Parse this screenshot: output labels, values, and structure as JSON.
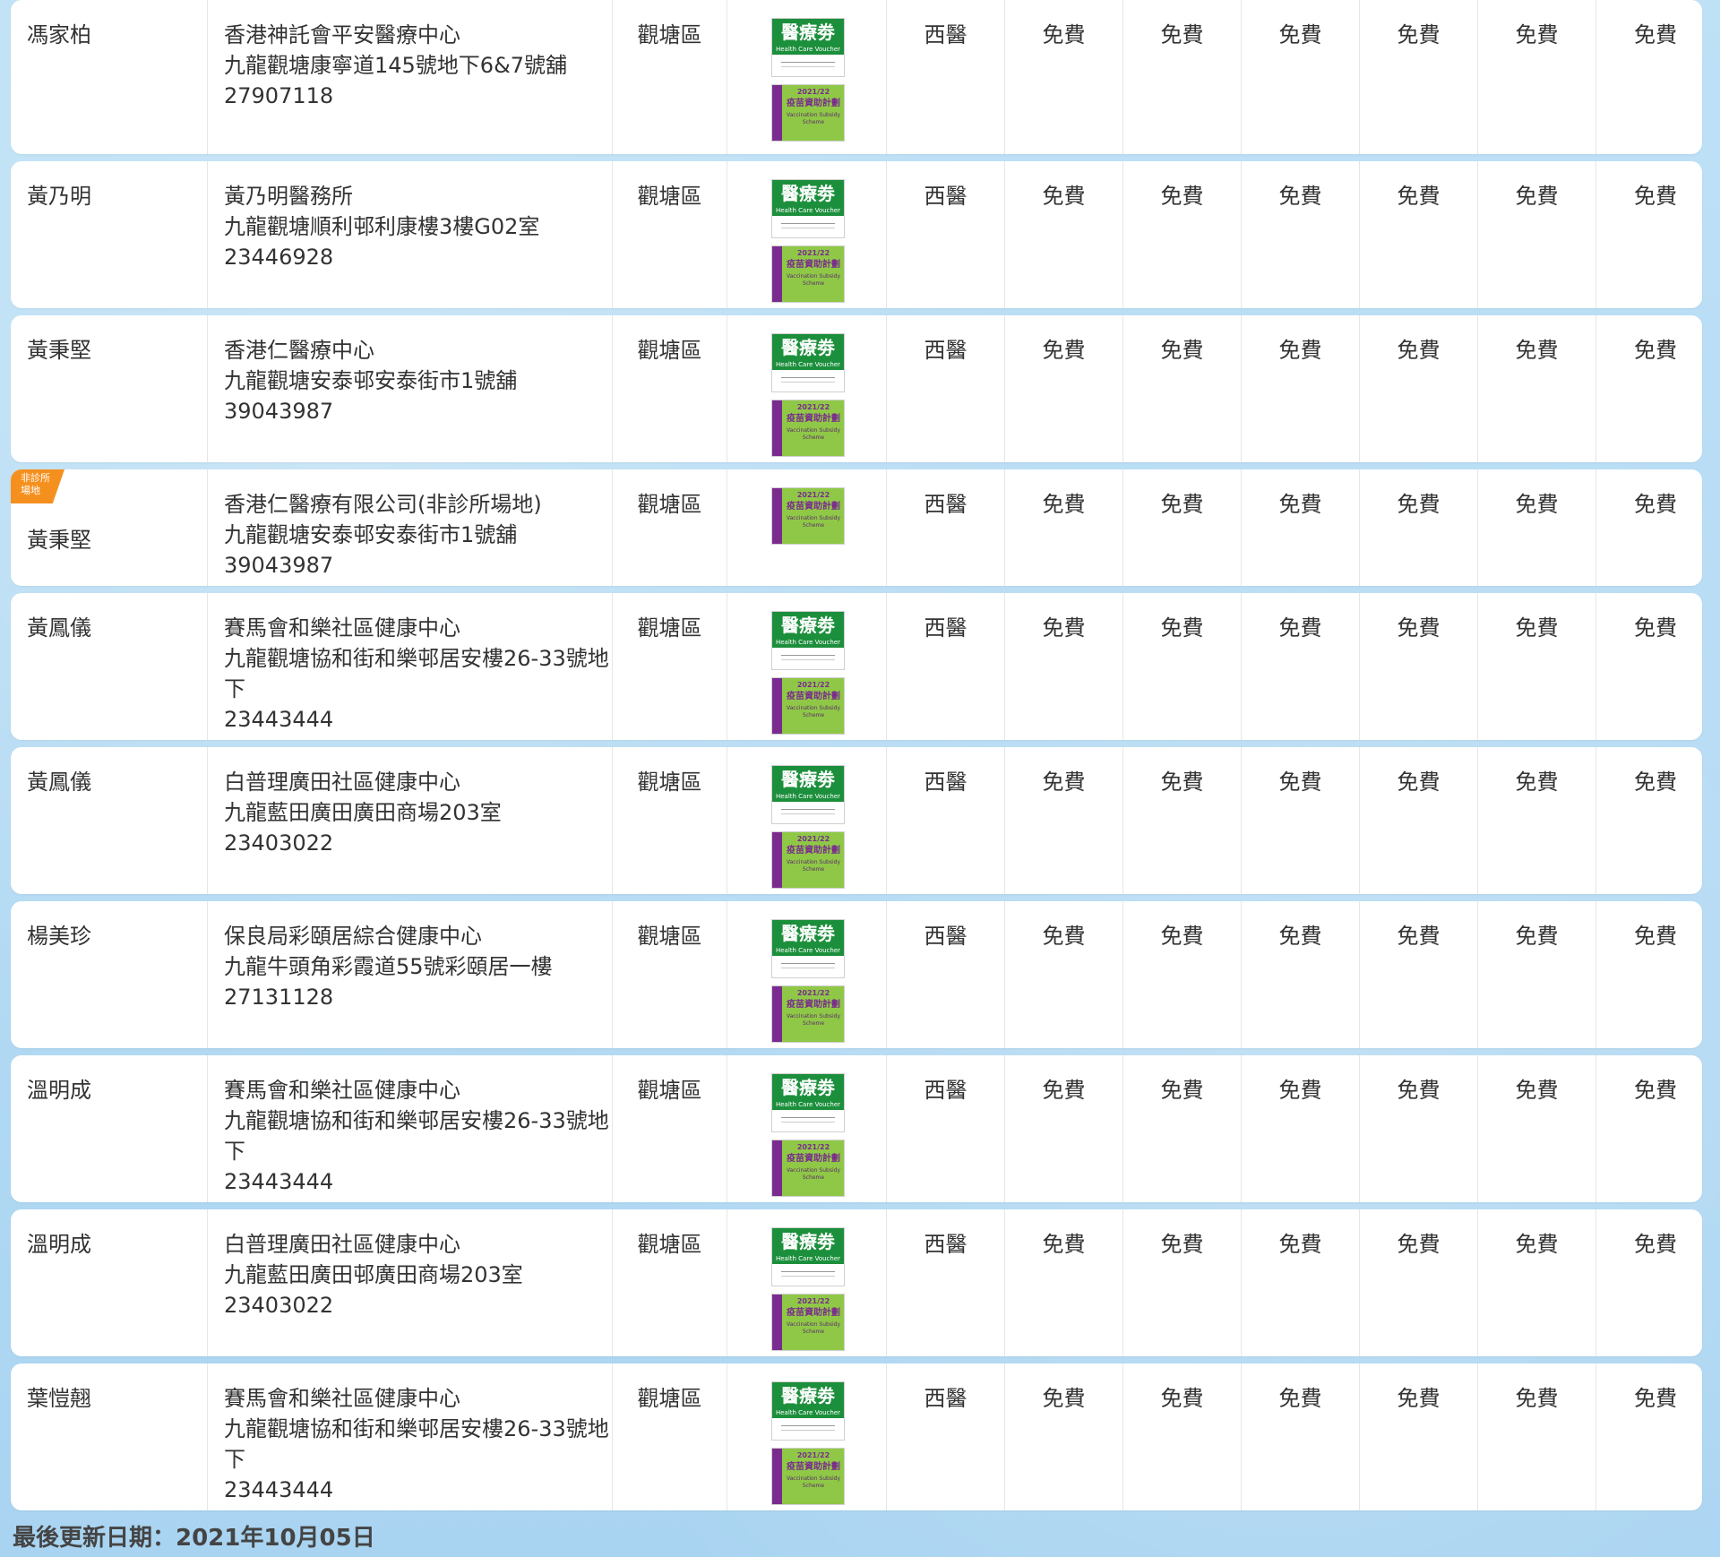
{
  "hcv_badge": {
    "title": "醫療劵",
    "subtitle": "Health Care Voucher"
  },
  "vss_badge": {
    "year": "2021/22",
    "title": "疫苗資助計劃",
    "subtitle": "Vaccination Subsidy Scheme"
  },
  "rows": [
    {
      "doctor": "馮家柏",
      "clinic": "香港神託會平安醫療中心",
      "address": "九龍觀塘康寧道145號地下6&7號舖",
      "phone": "27907118",
      "district": "觀塘區",
      "hcv": true,
      "vss": true,
      "tag": "",
      "type": "西醫",
      "fees": [
        "免費",
        "免費",
        "免費",
        "免費",
        "免費",
        "免費"
      ]
    },
    {
      "doctor": "黃乃明",
      "clinic": "黃乃明醫務所",
      "address": "九龍觀塘順利邨利康樓3樓G02室",
      "phone": "23446928",
      "district": "觀塘區",
      "hcv": true,
      "vss": true,
      "tag": "",
      "type": "西醫",
      "fees": [
        "免費",
        "免費",
        "免費",
        "免費",
        "免費",
        "免費"
      ]
    },
    {
      "doctor": "黃秉堅",
      "clinic": "香港仁醫療中心",
      "address": "九龍觀塘安泰邨安泰街市1號舖",
      "phone": "39043987",
      "district": "觀塘區",
      "hcv": true,
      "vss": true,
      "tag": "",
      "type": "西醫",
      "fees": [
        "免費",
        "免費",
        "免費",
        "免費",
        "免費",
        "免費"
      ]
    },
    {
      "doctor": "黃秉堅",
      "clinic": "香港仁醫療有限公司(非診所場地)",
      "address": "九龍觀塘安泰邨安泰街市1號舖",
      "phone": "39043987",
      "district": "觀塘區",
      "hcv": false,
      "vss": true,
      "tag": "非診所\n場地",
      "type": "西醫",
      "fees": [
        "免費",
        "免費",
        "免費",
        "免費",
        "免費",
        "免費"
      ]
    },
    {
      "doctor": "黃鳳儀",
      "clinic": "賽馬會和樂社區健康中心",
      "address": "九龍觀塘協和街和樂邨居安樓26-33號地\n下",
      "phone": "23443444",
      "district": "觀塘區",
      "hcv": true,
      "vss": true,
      "tag": "",
      "type": "西醫",
      "fees": [
        "免費",
        "免費",
        "免費",
        "免費",
        "免費",
        "免費"
      ]
    },
    {
      "doctor": "黃鳳儀",
      "clinic": "白普理廣田社區健康中心",
      "address": "九龍藍田廣田廣田商場203室",
      "phone": "23403022",
      "district": "觀塘區",
      "hcv": true,
      "vss": true,
      "tag": "",
      "type": "西醫",
      "fees": [
        "免費",
        "免費",
        "免費",
        "免費",
        "免費",
        "免費"
      ]
    },
    {
      "doctor": "楊美珍",
      "clinic": "保良局彩頤居綜合健康中心",
      "address": "九龍牛頭角彩霞道55號彩頤居一樓",
      "phone": "27131128",
      "district": "觀塘區",
      "hcv": true,
      "vss": true,
      "tag": "",
      "type": "西醫",
      "fees": [
        "免費",
        "免費",
        "免費",
        "免費",
        "免費",
        "免費"
      ]
    },
    {
      "doctor": "溫明成",
      "clinic": "賽馬會和樂社區健康中心",
      "address": "九龍觀塘協和街和樂邨居安樓26-33號地\n下",
      "phone": "23443444",
      "district": "觀塘區",
      "hcv": true,
      "vss": true,
      "tag": "",
      "type": "西醫",
      "fees": [
        "免費",
        "免費",
        "免費",
        "免費",
        "免費",
        "免費"
      ]
    },
    {
      "doctor": "溫明成",
      "clinic": "白普理廣田社區健康中心",
      "address": "九龍藍田廣田邨廣田商場203室",
      "phone": "23403022",
      "district": "觀塘區",
      "hcv": true,
      "vss": true,
      "tag": "",
      "type": "西醫",
      "fees": [
        "免費",
        "免費",
        "免費",
        "免費",
        "免費",
        "免費"
      ]
    },
    {
      "doctor": "葉愷翹",
      "clinic": "賽馬會和樂社區健康中心",
      "address": "九龍觀塘協和街和樂邨居安樓26-33號地\n下",
      "phone": "23443444",
      "district": "觀塘區",
      "hcv": true,
      "vss": true,
      "tag": "",
      "type": "西醫",
      "fees": [
        "免費",
        "免費",
        "免費",
        "免費",
        "免費",
        "免費"
      ]
    }
  ],
  "last_updated": "最後更新日期：2021年10月05日"
}
